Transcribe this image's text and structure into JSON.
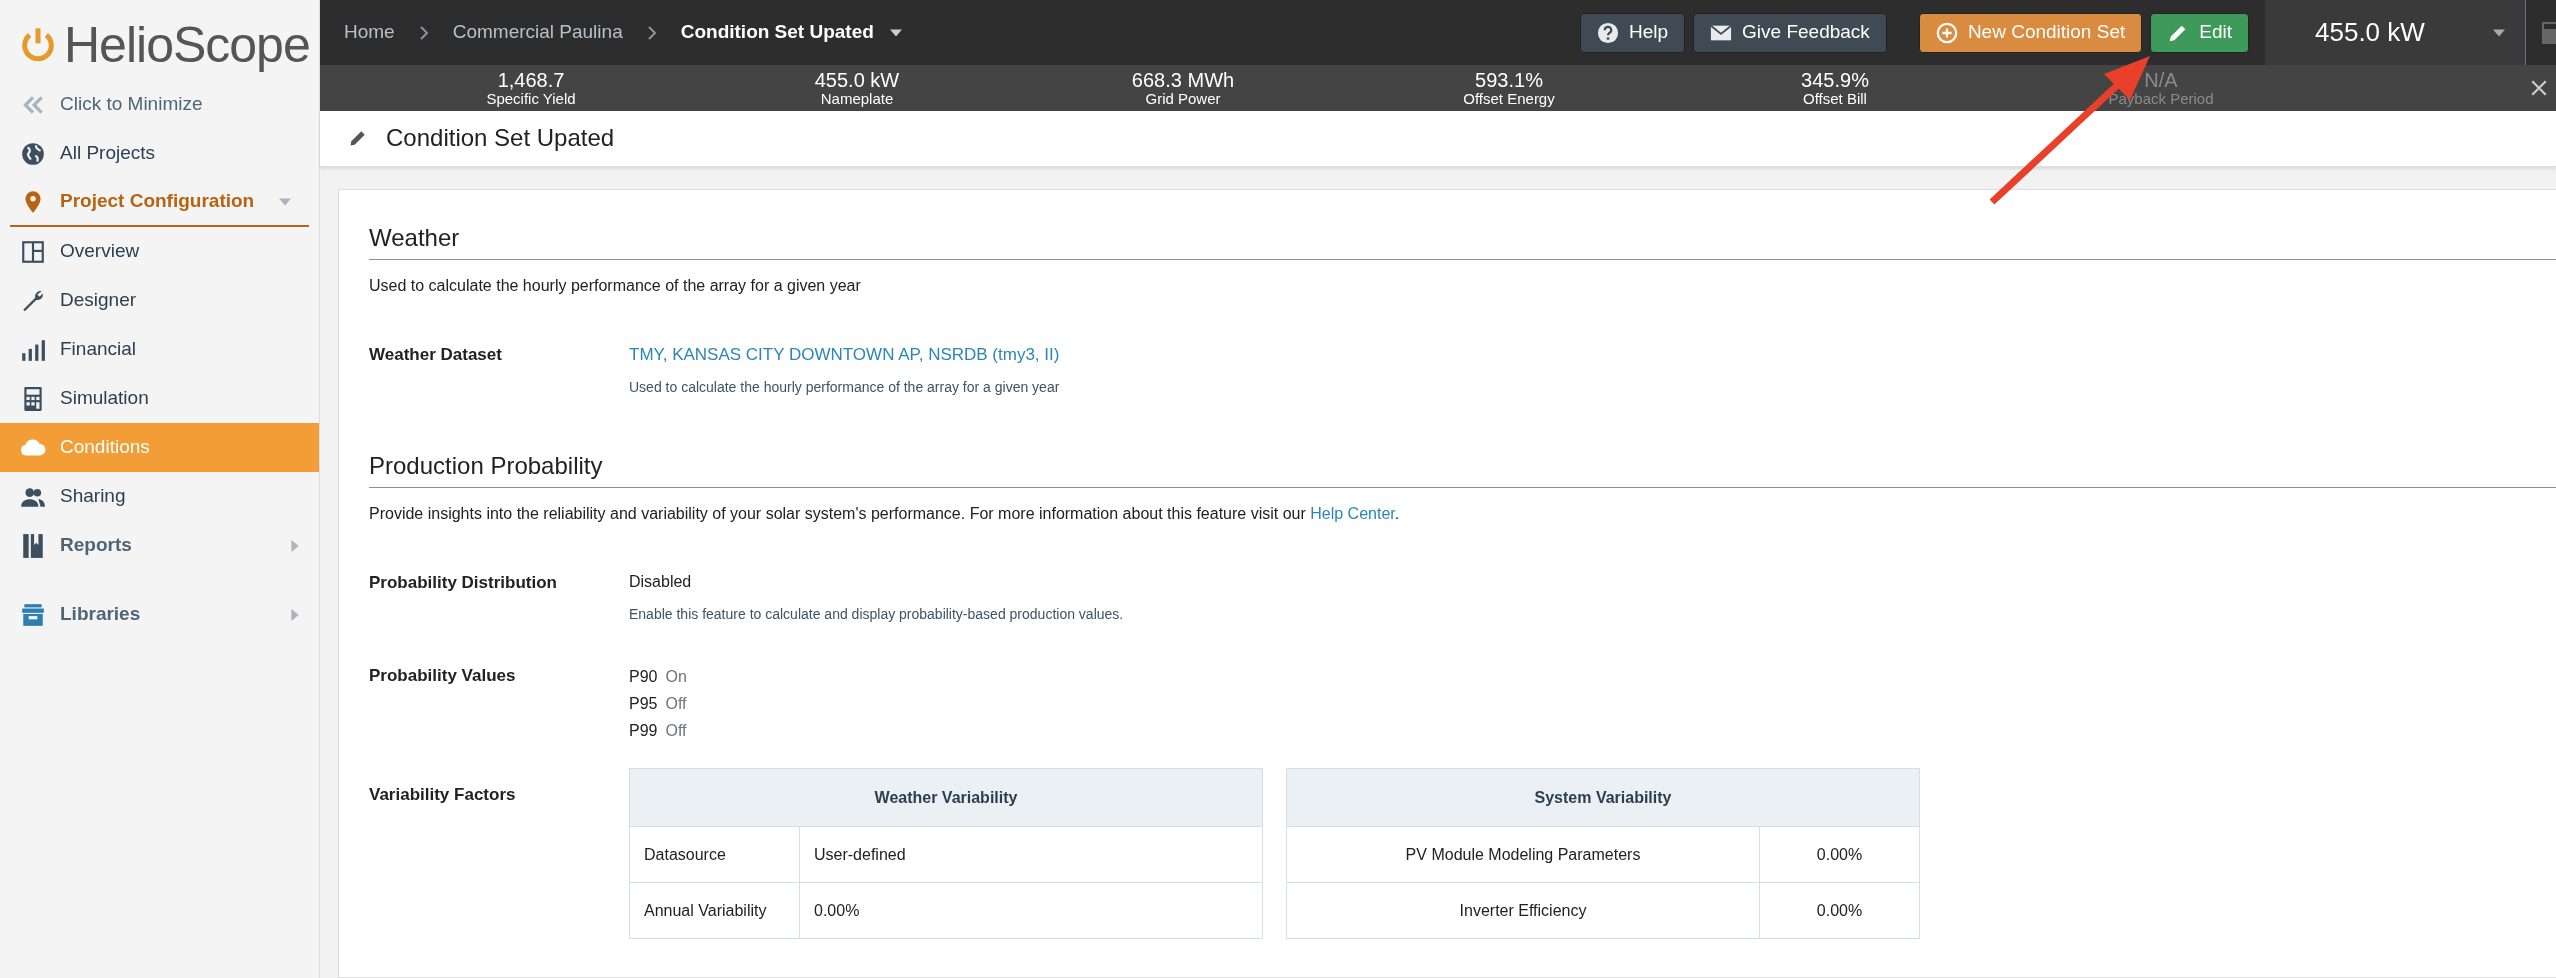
{
  "logo": {
    "text": "HelioScope"
  },
  "sidebar": {
    "items": [
      {
        "kind": "minimize",
        "label": "Click to Minimize",
        "selected": false
      },
      {
        "kind": "link",
        "label": "All Projects",
        "selected": false
      },
      {
        "kind": "section",
        "label": "Project Configuration",
        "selected": false,
        "expanded": true
      },
      {
        "kind": "link",
        "label": "Overview",
        "selected": false
      },
      {
        "kind": "link",
        "label": "Designer",
        "selected": false
      },
      {
        "kind": "link",
        "label": "Financial",
        "selected": false
      },
      {
        "kind": "link",
        "label": "Simulation",
        "selected": false
      },
      {
        "kind": "link",
        "label": "Conditions",
        "selected": true
      },
      {
        "kind": "link",
        "label": "Sharing",
        "selected": false
      },
      {
        "kind": "group",
        "label": "Reports",
        "selected": false,
        "expanded": false
      },
      {
        "kind": "group",
        "label": "Libraries",
        "selected": false,
        "expanded": false
      }
    ]
  },
  "breadcrumbs": [
    {
      "label": "Home",
      "current": false
    },
    {
      "label": "Commercial Paulina",
      "current": false
    },
    {
      "label": "Condition Set Upated",
      "current": true
    }
  ],
  "buttons": [
    {
      "kind": "dark",
      "label": "Help"
    },
    {
      "kind": "dark",
      "label": "Give Feedback"
    },
    {
      "kind": "warning",
      "label": "New Condition Set"
    },
    {
      "kind": "success",
      "label": "Edit"
    }
  ],
  "power_menu": {
    "value": "455.0 kW"
  },
  "stats": [
    {
      "value": "1,468.7",
      "label": "Specific Yield",
      "disabled": false
    },
    {
      "value": "455.0 kW",
      "label": "Nameplate",
      "disabled": false
    },
    {
      "value": "668.3 MWh",
      "label": "Grid Power",
      "disabled": false
    },
    {
      "value": "593.1%",
      "label": "Offset Energy",
      "disabled": false
    },
    {
      "value": "345.9%",
      "label": "Offset Bill",
      "disabled": false
    },
    {
      "value": "N/A",
      "label": "Payback Period",
      "disabled": true
    }
  ],
  "page_title": "Condition Set Upated",
  "sections": [
    {
      "title": "Weather",
      "description": "Used to calculate the hourly performance of the array for a given year",
      "fields": [
        {
          "kind": "link",
          "label": "Weather Dataset",
          "value": "TMY, KANSAS CITY DOWNTOWN AP, NSRDB (tmy3, II)",
          "hint": "Used to calculate the hourly performance of the array for a given year"
        }
      ]
    },
    {
      "title": "Production Probability",
      "description": "Provide insights into the reliability and variability of your solar system's performance. For more information about this feature visit our ",
      "link": "Help Center",
      "description_end": ".",
      "fields": [
        {
          "kind": "text",
          "label": "Probability Distribution",
          "value": "Disabled",
          "hint": "Enable this feature to calculate and display probability-based production values."
        },
        {
          "kind": "list",
          "label": "Probability Values",
          "items": [
            {
              "name": "P90",
              "value": "On"
            },
            {
              "name": "P95",
              "value": "Off"
            },
            {
              "name": "P99",
              "value": "Off"
            }
          ]
        },
        {
          "kind": "tables",
          "label": "Variability Factors",
          "tables": [
            {
              "title": "Weather Variability",
              "kind": "plain",
              "rows": [
                [
                  "Datasource",
                  "User-defined"
                ],
                [
                  "Annual Variability",
                  "0.00%"
                ]
              ]
            },
            {
              "title": "System Variability",
              "kind": "centered",
              "rows": [
                [
                  "PV Module Modeling Parameters",
                  "0.00%"
                ],
                [
                  "Inverter Efficiency",
                  "0.00%"
                ]
              ]
            }
          ]
        }
      ]
    }
  ]
}
